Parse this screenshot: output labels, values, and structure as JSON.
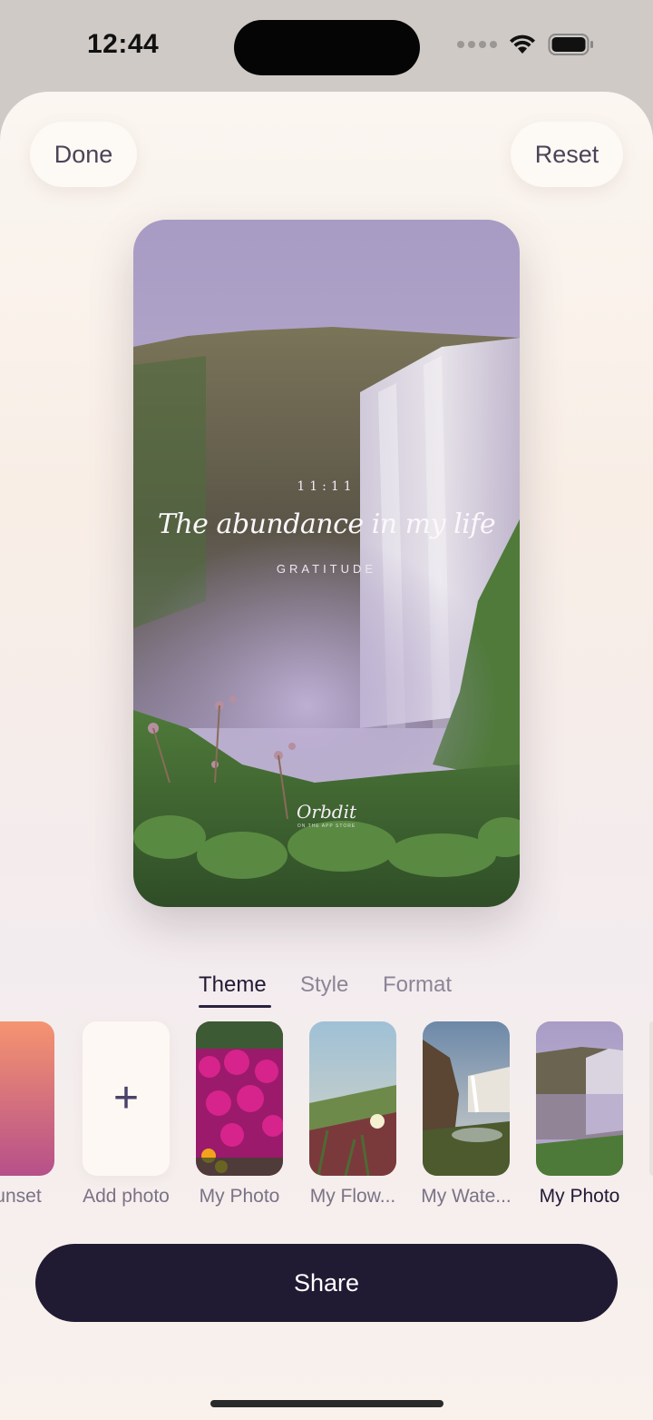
{
  "status_bar": {
    "time": "12:44",
    "icons": [
      "cellular-dots-icon",
      "wifi-icon",
      "battery-icon"
    ]
  },
  "header": {
    "done_label": "Done",
    "reset_label": "Reset"
  },
  "preview": {
    "time_text": "11:11",
    "quote": "The abundance in my life",
    "category": "GRATITUDE",
    "logo": "Orbdit",
    "logo_sub": "ON THE APP STORE"
  },
  "tabs": [
    {
      "label": "Theme",
      "active": true
    },
    {
      "label": "Style",
      "active": false
    },
    {
      "label": "Format",
      "active": false
    }
  ],
  "themes": [
    {
      "label": "Sunset",
      "kind": "gradient",
      "selected": false
    },
    {
      "label": "Add photo",
      "kind": "add",
      "icon": "plus-icon",
      "selected": false
    },
    {
      "label": "My Photo",
      "kind": "photo-flowers",
      "selected": false
    },
    {
      "label": "My Flow...",
      "kind": "photo-iceplant",
      "selected": false
    },
    {
      "label": "My Wate...",
      "kind": "photo-waterfall",
      "selected": false
    },
    {
      "label": "My Photo",
      "kind": "photo-waterfall-purple",
      "selected": true
    }
  ],
  "share_label": "Share",
  "colors": {
    "accent_dark": "#211a33",
    "selected_outline": "#e9a7a6",
    "tab_inactive": "#8c8597"
  }
}
